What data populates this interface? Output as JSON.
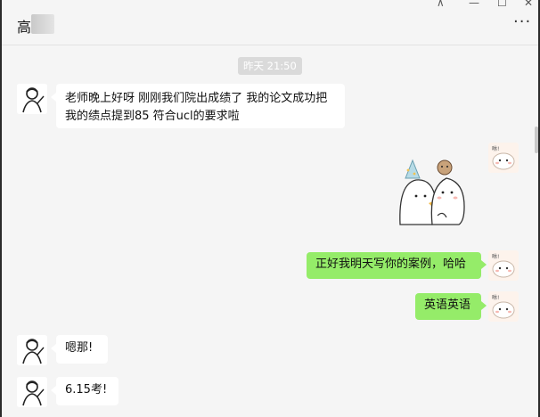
{
  "window": {
    "title_char": "高",
    "pin_glyph": "⊼",
    "minimize_glyph": "—",
    "maximize_glyph": "☐",
    "close_glyph": "✕",
    "more_glyph": "···"
  },
  "chat": {
    "timestamp": "昨天 21:50",
    "messages": [
      {
        "side": "left",
        "lines": [
          "老师晚上好呀 刚刚我们院出成绩了 我的论文成功把",
          "我的绩点提到85 符合ucl的要求啦"
        ]
      },
      {
        "side": "right",
        "type": "sticker",
        "sticker": "celebration-sticker"
      },
      {
        "side": "right",
        "text": "正好我明天写你的案例，哈哈"
      },
      {
        "side": "right",
        "text": "英语英语"
      },
      {
        "side": "left",
        "text": "嗯那!"
      },
      {
        "side": "left",
        "text": "6.15考!"
      }
    ]
  },
  "self_avatar_label": "咻!",
  "colors": {
    "background": "#f5f5f5",
    "bubble_in": "#ffffff",
    "bubble_out": "#95ec69",
    "timestamp_bg": "#dadada"
  }
}
